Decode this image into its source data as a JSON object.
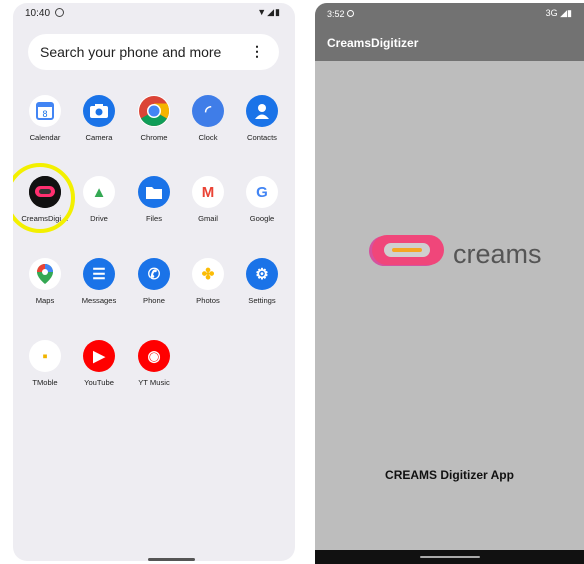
{
  "left_screen": {
    "status": {
      "time": "10:40",
      "icons": "▼◢▮"
    },
    "search": {
      "placeholder": "Search your phone and more",
      "menu": "⋮"
    },
    "apps": [
      {
        "label": "Calendar",
        "icon": "calendar-icon",
        "glyph": "8",
        "bg": "#ffffff",
        "fg": "#1a73e8"
      },
      {
        "label": "Camera",
        "icon": "camera-icon",
        "glyph": "●",
        "bg": "#1a73e8",
        "fg": "#ffffff"
      },
      {
        "label": "Chrome",
        "icon": "chrome-icon",
        "glyph": "",
        "bg": "#ffffff",
        "fg": "#ffffff"
      },
      {
        "label": "Clock",
        "icon": "clock-icon",
        "glyph": "◜",
        "bg": "#3f7de8",
        "fg": "#ffffff"
      },
      {
        "label": "Contacts",
        "icon": "contacts-icon",
        "glyph": "●",
        "bg": "#1a73e8",
        "fg": "#ffffff"
      },
      {
        "label": "CreamsDigi…",
        "icon": "creams-icon",
        "glyph": "",
        "bg": "#111111",
        "fg": "#ff2f6f"
      },
      {
        "label": "Drive",
        "icon": "drive-icon",
        "glyph": "▲",
        "bg": "#ffffff",
        "fg": "#34a853"
      },
      {
        "label": "Files",
        "icon": "files-icon",
        "glyph": "▇",
        "bg": "#1a73e8",
        "fg": "#ffffff"
      },
      {
        "label": "Gmail",
        "icon": "gmail-icon",
        "glyph": "M",
        "bg": "#ffffff",
        "fg": "#ea4335"
      },
      {
        "label": "Google",
        "icon": "google-icon",
        "glyph": "G",
        "bg": "#ffffff",
        "fg": "#4285f4"
      },
      {
        "label": "Maps",
        "icon": "maps-icon",
        "glyph": "●",
        "bg": "#ffffff",
        "fg": "#ea4335"
      },
      {
        "label": "Messages",
        "icon": "messages-icon",
        "glyph": "☰",
        "bg": "#1a73e8",
        "fg": "#ffffff"
      },
      {
        "label": "Phone",
        "icon": "phone-icon",
        "glyph": "✆",
        "bg": "#1a73e8",
        "fg": "#ffffff"
      },
      {
        "label": "Photos",
        "icon": "photos-icon",
        "glyph": "✤",
        "bg": "#ffffff",
        "fg": "#fbbc05"
      },
      {
        "label": "Settings",
        "icon": "settings-icon",
        "glyph": "⚙",
        "bg": "#1a73e8",
        "fg": "#ffffff"
      },
      {
        "label": "TMoble",
        "icon": "tmobile-icon",
        "glyph": "▪",
        "bg": "#ffffff",
        "fg": "#f0b400"
      },
      {
        "label": "YouTube",
        "icon": "youtube-icon",
        "glyph": "▶",
        "bg": "#ff0000",
        "fg": "#ffffff"
      },
      {
        "label": "YT Music",
        "icon": "yt-music-icon",
        "glyph": "◉",
        "bg": "#ff0000",
        "fg": "#ffffff"
      }
    ],
    "highlight_color": "#f3f000"
  },
  "right_screen": {
    "status": {
      "time": "3:52",
      "icons": "3G ◢▮"
    },
    "app_title": "CreamsDigitizer",
    "logo_word": "creams",
    "caption": "CREAMS Digitizer App",
    "colors": {
      "toolbar": "#727272",
      "background": "#bdbdbd",
      "logo_pink": "#f0467a",
      "logo_orange": "#f5a623"
    }
  }
}
